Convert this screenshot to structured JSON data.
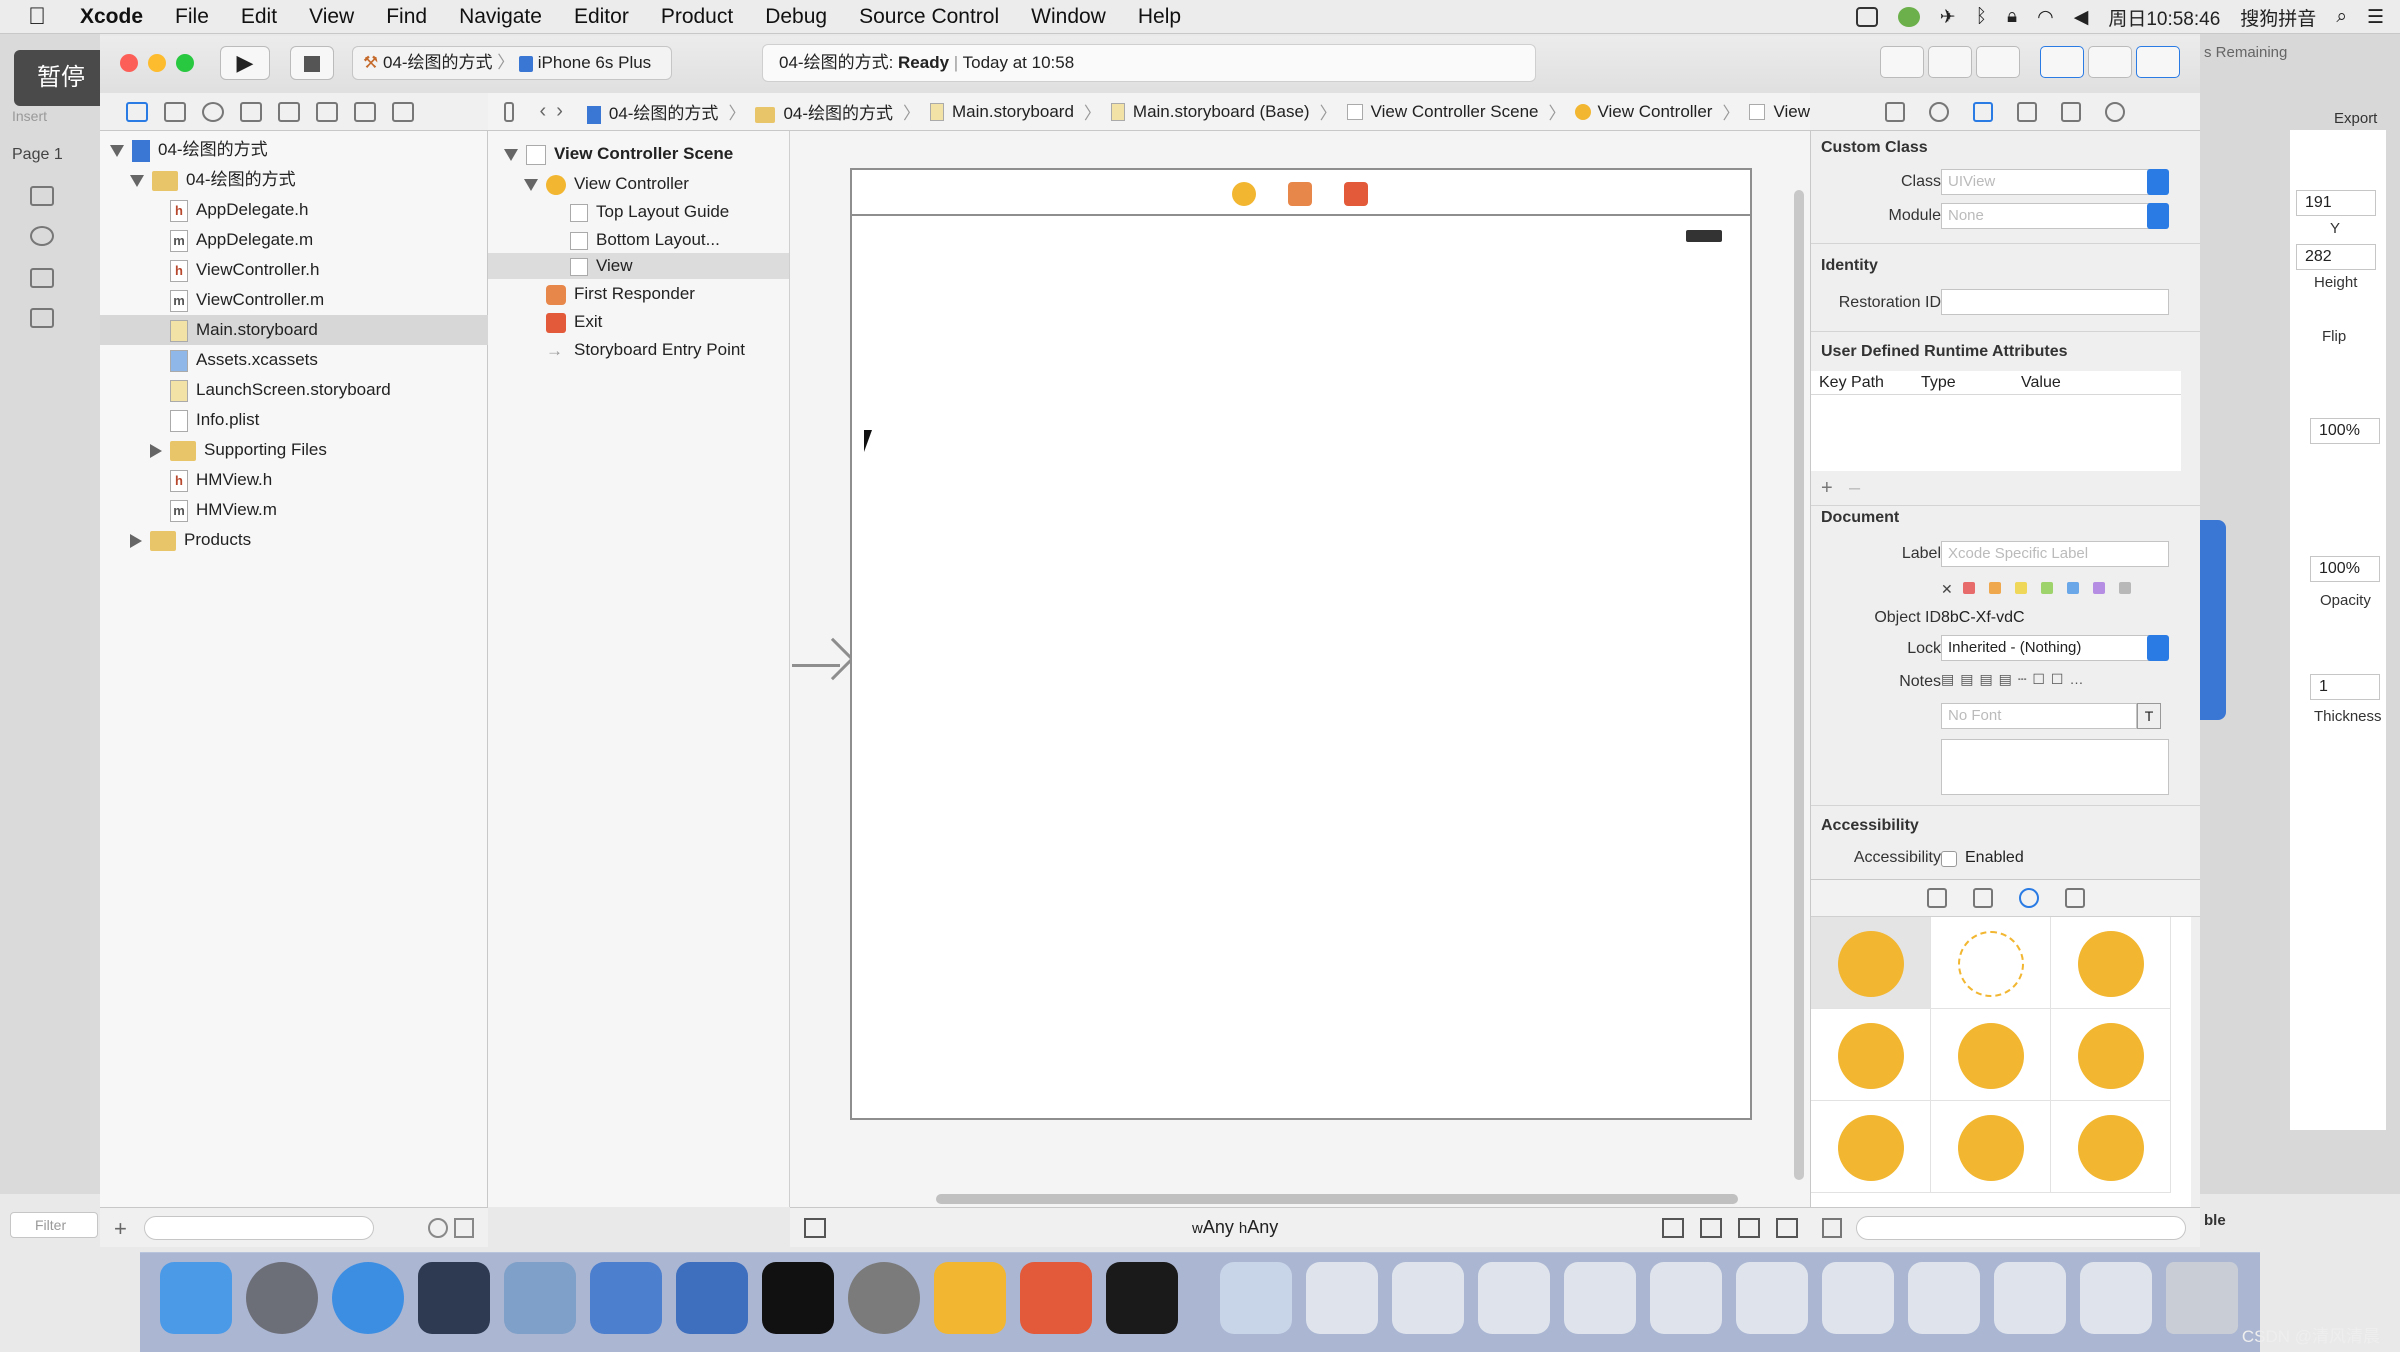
{
  "menubar": {
    "app": "Xcode",
    "items": [
      "File",
      "Edit",
      "View",
      "Find",
      "Navigate",
      "Editor",
      "Product",
      "Debug",
      "Source Control",
      "Window",
      "Help"
    ],
    "clock": "周日10:58:46",
    "input_method": "搜狗拼音"
  },
  "overlay": {
    "pause_label": "暂停",
    "insert_label": "Insert",
    "page_label": "Page 1",
    "filter_placeholder": "Filter"
  },
  "toolbar": {
    "scheme_project": "04-绘图的方式",
    "scheme_device": "iPhone 6s Plus",
    "status_project": "04-绘图的方式: ",
    "status_state": "Ready",
    "status_time": "Today at 10:58"
  },
  "navigator": {
    "items": [
      {
        "label": "04-绘图的方式",
        "type": "project"
      },
      {
        "label": "04-绘图的方式",
        "type": "folder"
      },
      {
        "label": "AppDelegate.h",
        "type": "h"
      },
      {
        "label": "AppDelegate.m",
        "type": "m"
      },
      {
        "label": "ViewController.h",
        "type": "h"
      },
      {
        "label": "ViewController.m",
        "type": "m"
      },
      {
        "label": "Main.storyboard",
        "type": "storyboard"
      },
      {
        "label": "Assets.xcassets",
        "type": "assets"
      },
      {
        "label": "LaunchScreen.storyboard",
        "type": "storyboard"
      },
      {
        "label": "Info.plist",
        "type": "plist"
      },
      {
        "label": "Supporting Files",
        "type": "folder"
      },
      {
        "label": "HMView.h",
        "type": "h"
      },
      {
        "label": "HMView.m",
        "type": "m"
      },
      {
        "label": "Products",
        "type": "folder"
      }
    ]
  },
  "jumpbar": {
    "crumbs": [
      "04-绘图的方式",
      "04-绘图的方式",
      "Main.storyboard",
      "Main.storyboard (Base)",
      "View Controller Scene",
      "View Controller",
      "View"
    ]
  },
  "outline": {
    "items": [
      "View Controller Scene",
      "View Controller",
      "Top Layout Guide",
      "Bottom Layout...",
      "View",
      "First Responder",
      "Exit",
      "Storyboard Entry Point"
    ]
  },
  "canvas": {
    "size_class": "wAny hAny",
    "w_prefix": "w",
    "w_value": "Any",
    "h_prefix": "h",
    "h_value": "Any"
  },
  "inspector": {
    "custom_class": {
      "title": "Custom Class",
      "class_label": "Class",
      "class_placeholder": "UIView",
      "module_label": "Module",
      "module_placeholder": "None"
    },
    "identity": {
      "title": "Identity",
      "restoration_label": "Restoration ID"
    },
    "udra": {
      "title": "User Defined Runtime Attributes",
      "col_keypath": "Key Path",
      "col_type": "Type",
      "col_value": "Value"
    },
    "document": {
      "title": "Document",
      "label_label": "Label",
      "label_placeholder": "Xcode Specific Label",
      "object_id_label": "Object ID",
      "object_id": "8bC-Xf-vdC",
      "lock_label": "Lock",
      "lock_value": "Inherited - (Nothing)",
      "notes_label": "Notes",
      "font_placeholder": "No Font"
    },
    "accessibility": {
      "title": "Accessibility",
      "label": "Accessibility",
      "enabled": "Enabled"
    },
    "swatch_colors": [
      "#e76b6b",
      "#f0a84e",
      "#efd75a",
      "#9ed26a",
      "#6aa7e8",
      "#b58ee3",
      "#b8b8b8"
    ]
  },
  "rightpanel": {
    "remaining": "s Remaining",
    "export": "Export",
    "y_value": "191",
    "y_label": "Y",
    "height_value": "282",
    "height_label": "Height",
    "flip_label": "Flip",
    "pct1": "100%",
    "opacity_value": "100%",
    "opacity_label": "Opacity",
    "thickness_value": "1",
    "thickness_label": "Thickness",
    "ble": "ble"
  },
  "watermark": "CSDN @清风清晨"
}
